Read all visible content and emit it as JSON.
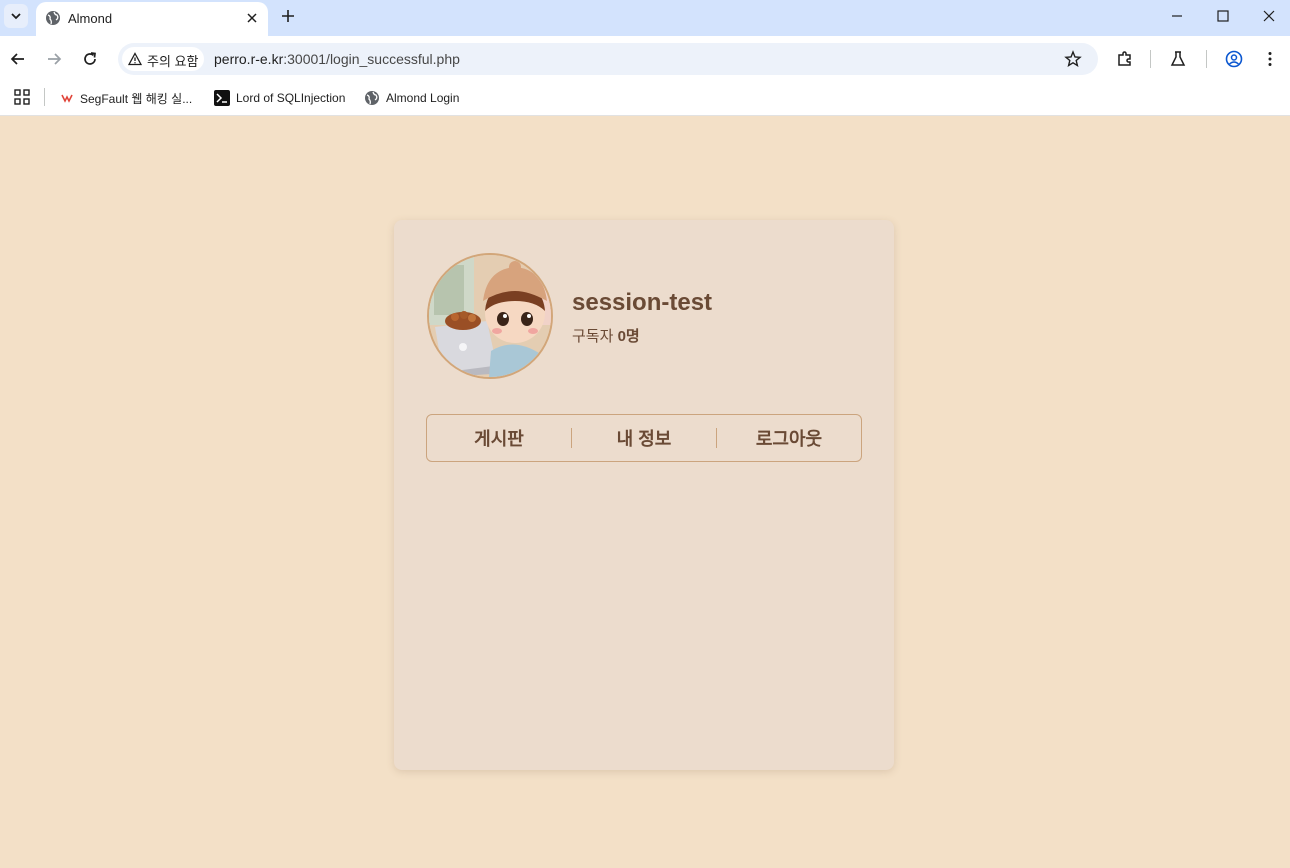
{
  "browser": {
    "tab_title": "Almond",
    "security_label": "주의 요함",
    "url_host": "perro.r-e.kr",
    "url_rest": ":30001/login_successful.php",
    "bookmarks": [
      {
        "label": "SegFault 웹 해킹 실..."
      },
      {
        "label": "Lord of SQLInjection"
      },
      {
        "label": "Almond Login"
      }
    ]
  },
  "profile": {
    "username": "session-test",
    "subscribers_label": "구독자",
    "subscribers_count": "0명"
  },
  "nav": {
    "board": "게시판",
    "my_info": "내 정보",
    "logout": "로그아웃"
  },
  "colors": {
    "page_bg": "#f3e0c7",
    "card_bg": "#ecdccd",
    "text": "#6a4a35",
    "border": "#cba47e"
  }
}
